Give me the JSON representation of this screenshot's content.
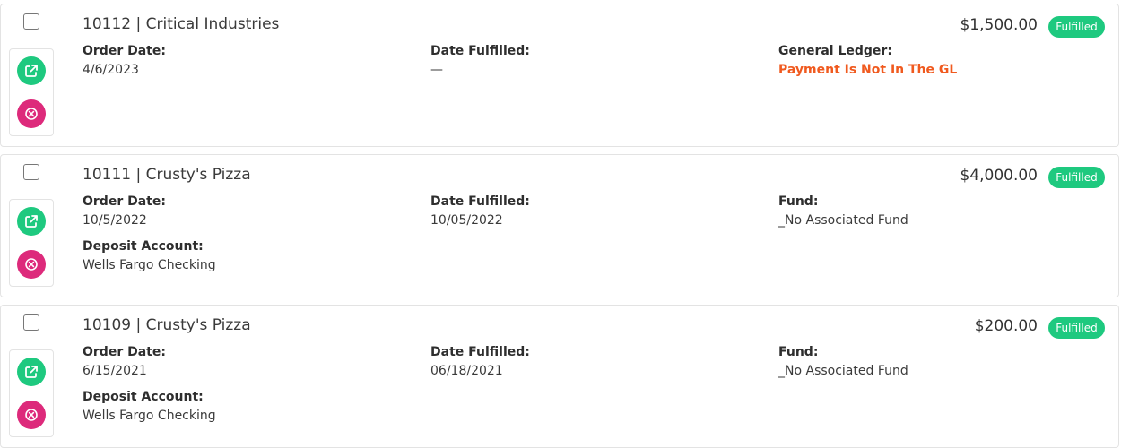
{
  "orders": [
    {
      "title": "10112 | Critical Industries",
      "amount": "$1,500.00",
      "status": "Fulfilled",
      "order_date_label": "Order Date:",
      "order_date": "4/6/2023",
      "fulfilled_label": "Date Fulfilled:",
      "fulfilled": "—",
      "third_label": "General Ledger:",
      "third_value": "Payment Is Not In The GL"
    },
    {
      "title": "10111 | Crusty's Pizza",
      "amount": "$4,000.00",
      "status": "Fulfilled",
      "order_date_label": "Order Date:",
      "order_date": "10/5/2022",
      "fulfilled_label": "Date Fulfilled:",
      "fulfilled": "10/05/2022",
      "third_label": "Fund:",
      "third_value": "_No Associated Fund",
      "deposit_label": "Deposit Account:",
      "deposit_value": "Wells Fargo Checking"
    },
    {
      "title": "10109 | Crusty's Pizza",
      "amount": "$200.00",
      "status": "Fulfilled",
      "order_date_label": "Order Date:",
      "order_date": "6/15/2021",
      "fulfilled_label": "Date Fulfilled:",
      "fulfilled": "06/18/2021",
      "third_label": "Fund:",
      "third_value": "_No Associated Fund",
      "deposit_label": "Deposit Account:",
      "deposit_value": "Wells Fargo Checking"
    }
  ],
  "icons": {
    "open": "external-link-icon",
    "cancel": "cancel-circle-icon"
  },
  "colors": {
    "success": "#1ec97f",
    "danger": "#dd2a7b",
    "warning_text": "#f05a1f"
  }
}
